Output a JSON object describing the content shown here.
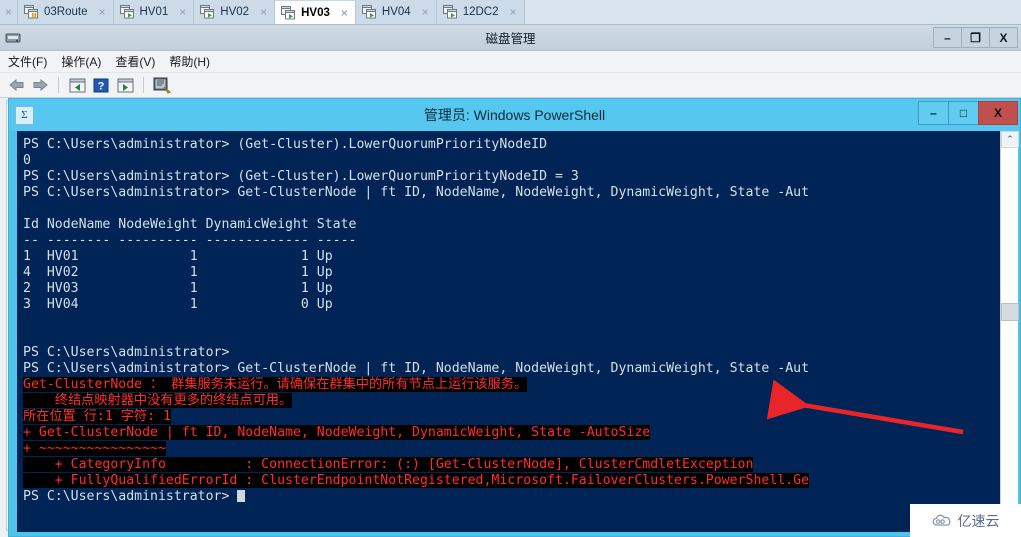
{
  "tabstrip": {
    "cut_tab_close": "×",
    "tabs": [
      {
        "label": "03Route",
        "icon": "vm-paused-icon",
        "active": false,
        "close": "×"
      },
      {
        "label": "HV01",
        "icon": "vm-running-icon",
        "active": false,
        "close": "×"
      },
      {
        "label": "HV02",
        "icon": "vm-running-icon",
        "active": false,
        "close": "×"
      },
      {
        "label": "HV03",
        "icon": "vm-running-icon",
        "active": true,
        "close": "×"
      },
      {
        "label": "HV04",
        "icon": "vm-running-icon",
        "active": false,
        "close": "×"
      },
      {
        "label": "12DC2",
        "icon": "vm-running-icon",
        "active": false,
        "close": "×"
      }
    ]
  },
  "disk_manager": {
    "title": "磁盘管理",
    "window_buttons": {
      "minimize": "–",
      "restore": "❐",
      "close": "X"
    },
    "menu": [
      "文件(F)",
      "操作(A)",
      "查看(V)",
      "帮助(H)"
    ],
    "toolbar": {
      "back": "back-arrow-icon",
      "forward": "forward-arrow-icon",
      "show_pane": "show-pane-icon",
      "help": "?",
      "hide_pane": "hide-pane-icon",
      "rescan": "rescan-disks-icon"
    }
  },
  "powershell": {
    "title": "管理员: Windows PowerShell",
    "sysicon": "Σ",
    "window_buttons": {
      "minimize": "–",
      "maximize": "□",
      "close": "X"
    },
    "colors": {
      "titlebar": "#56c7ef",
      "console_bg": "#012456",
      "text": "#d8dfe8",
      "error": "#ff2d2d",
      "error_bg": "#000000",
      "close_button": "#c0504d",
      "annotation_arrow": "#e8262a"
    },
    "scrollbar": {
      "up_arrow": "⌃",
      "down_arrow": "⌄"
    },
    "console_lines": [
      {
        "kind": "normal",
        "text": "PS C:\\Users\\administrator> (Get-Cluster).LowerQuorumPriorityNodeID"
      },
      {
        "kind": "normal",
        "text": "0"
      },
      {
        "kind": "normal",
        "text": "PS C:\\Users\\administrator> (Get-Cluster).LowerQuorumPriorityNodeID = 3"
      },
      {
        "kind": "normal",
        "text": "PS C:\\Users\\administrator> Get-ClusterNode | ft ID, NodeName, NodeWeight, DynamicWeight, State -Aut"
      },
      {
        "kind": "normal",
        "text": ""
      },
      {
        "kind": "normal",
        "text": "Id NodeName NodeWeight DynamicWeight State"
      },
      {
        "kind": "normal",
        "text": "-- -------- ---------- ------------- -----"
      },
      {
        "kind": "normal",
        "text": "1  HV01              1             1 Up"
      },
      {
        "kind": "normal",
        "text": "4  HV02              1             1 Up"
      },
      {
        "kind": "normal",
        "text": "2  HV03              1             1 Up"
      },
      {
        "kind": "normal",
        "text": "3  HV04              1             0 Up"
      },
      {
        "kind": "normal",
        "text": ""
      },
      {
        "kind": "normal",
        "text": ""
      },
      {
        "kind": "normal",
        "text": "PS C:\\Users\\administrator>"
      },
      {
        "kind": "normal",
        "text": "PS C:\\Users\\administrator> Get-ClusterNode | ft ID, NodeName, NodeWeight, DynamicWeight, State -Aut"
      },
      {
        "kind": "error",
        "text": "Get-ClusterNode ： 群集服务未运行。请确保在群集中的所有节点上运行该服务。"
      },
      {
        "kind": "error",
        "text": "    终结点映射器中没有更多的终结点可用。"
      },
      {
        "kind": "error",
        "text": "所在位置 行:1 字符: 1"
      },
      {
        "kind": "error",
        "text": "+ Get-ClusterNode | ft ID, NodeName, NodeWeight, DynamicWeight, State -AutoSize"
      },
      {
        "kind": "error",
        "text": "+ ~~~~~~~~~~~~~~~~"
      },
      {
        "kind": "error",
        "text": "    + CategoryInfo          : ConnectionError: (:) [Get-ClusterNode], ClusterCmdletException"
      },
      {
        "kind": "error",
        "text": "    + FullyQualifiedErrorId : ClusterEndpointNotRegistered,Microsoft.FailoverClusters.PowerShell.Ge"
      },
      {
        "kind": "prompt",
        "text": "PS C:\\Users\\administrator> "
      }
    ]
  },
  "watermark": {
    "text": "亿速云",
    "logo": "cloud-logo-icon"
  }
}
